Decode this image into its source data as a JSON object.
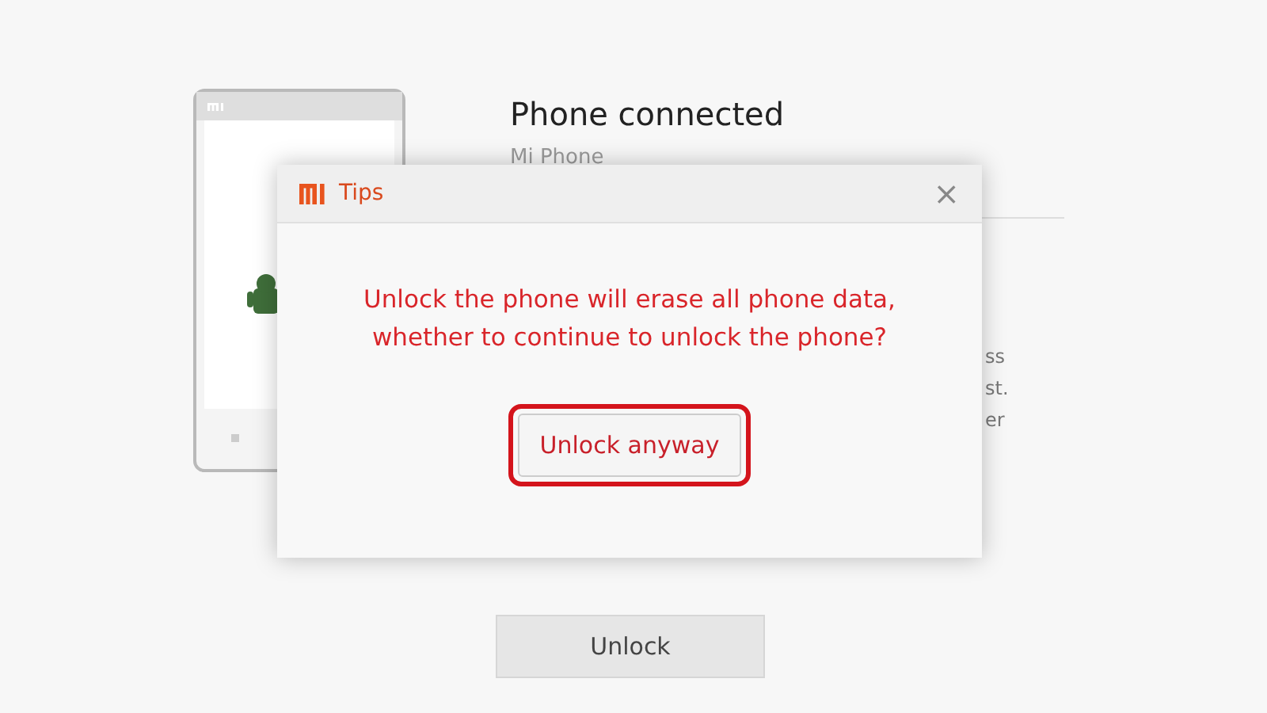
{
  "main": {
    "title": "Phone connected",
    "device": "Mi Phone",
    "fragments": [
      "ss",
      "st.",
      "er"
    ],
    "unlock_button": "Unlock"
  },
  "dialog": {
    "title": "Tips",
    "close": "×",
    "message": "Unlock the phone will erase all phone data, whether to continue to unlock the phone?",
    "button": {
      "label": "Unlock anyway",
      "highlighted": true
    }
  }
}
